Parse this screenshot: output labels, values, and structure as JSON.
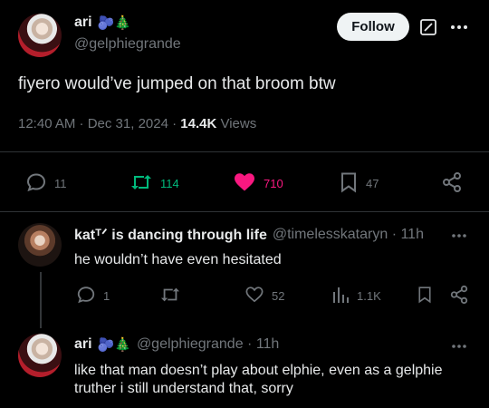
{
  "main": {
    "name": "ari",
    "emojis": "🫐🎄",
    "handle": "@gelphiegrande",
    "follow_label": "Follow",
    "text": "fiyero would’ve jumped on that broom btw",
    "time": "12:40 AM · Dec 31, 2024 · ",
    "views_count": "14.4K",
    "views_label": " Views",
    "stats": {
      "replies": "11",
      "reposts": "114",
      "likes": "710",
      "bookmarks": "47"
    }
  },
  "reply1": {
    "name": "katᵀᐟ is dancing through life",
    "handle": "@timelesskataryn · 11h",
    "text": "he wouldn’t have even hesitated",
    "stats": {
      "replies": "1",
      "likes": "52",
      "views": "1.1K"
    }
  },
  "reply2": {
    "name": "ari",
    "emojis": "🫐🎄",
    "handle": "@gelphiegrande · 11h",
    "text": "like that man doesn’t play about elphie, even as a gelphie truther i still understand that, sorry"
  },
  "colors": {
    "background": "#000000",
    "text": "#e7e9ea",
    "muted": "#71767b",
    "repost_green": "#00ba7c",
    "like_pink": "#f91880",
    "divider": "#2f3336"
  }
}
